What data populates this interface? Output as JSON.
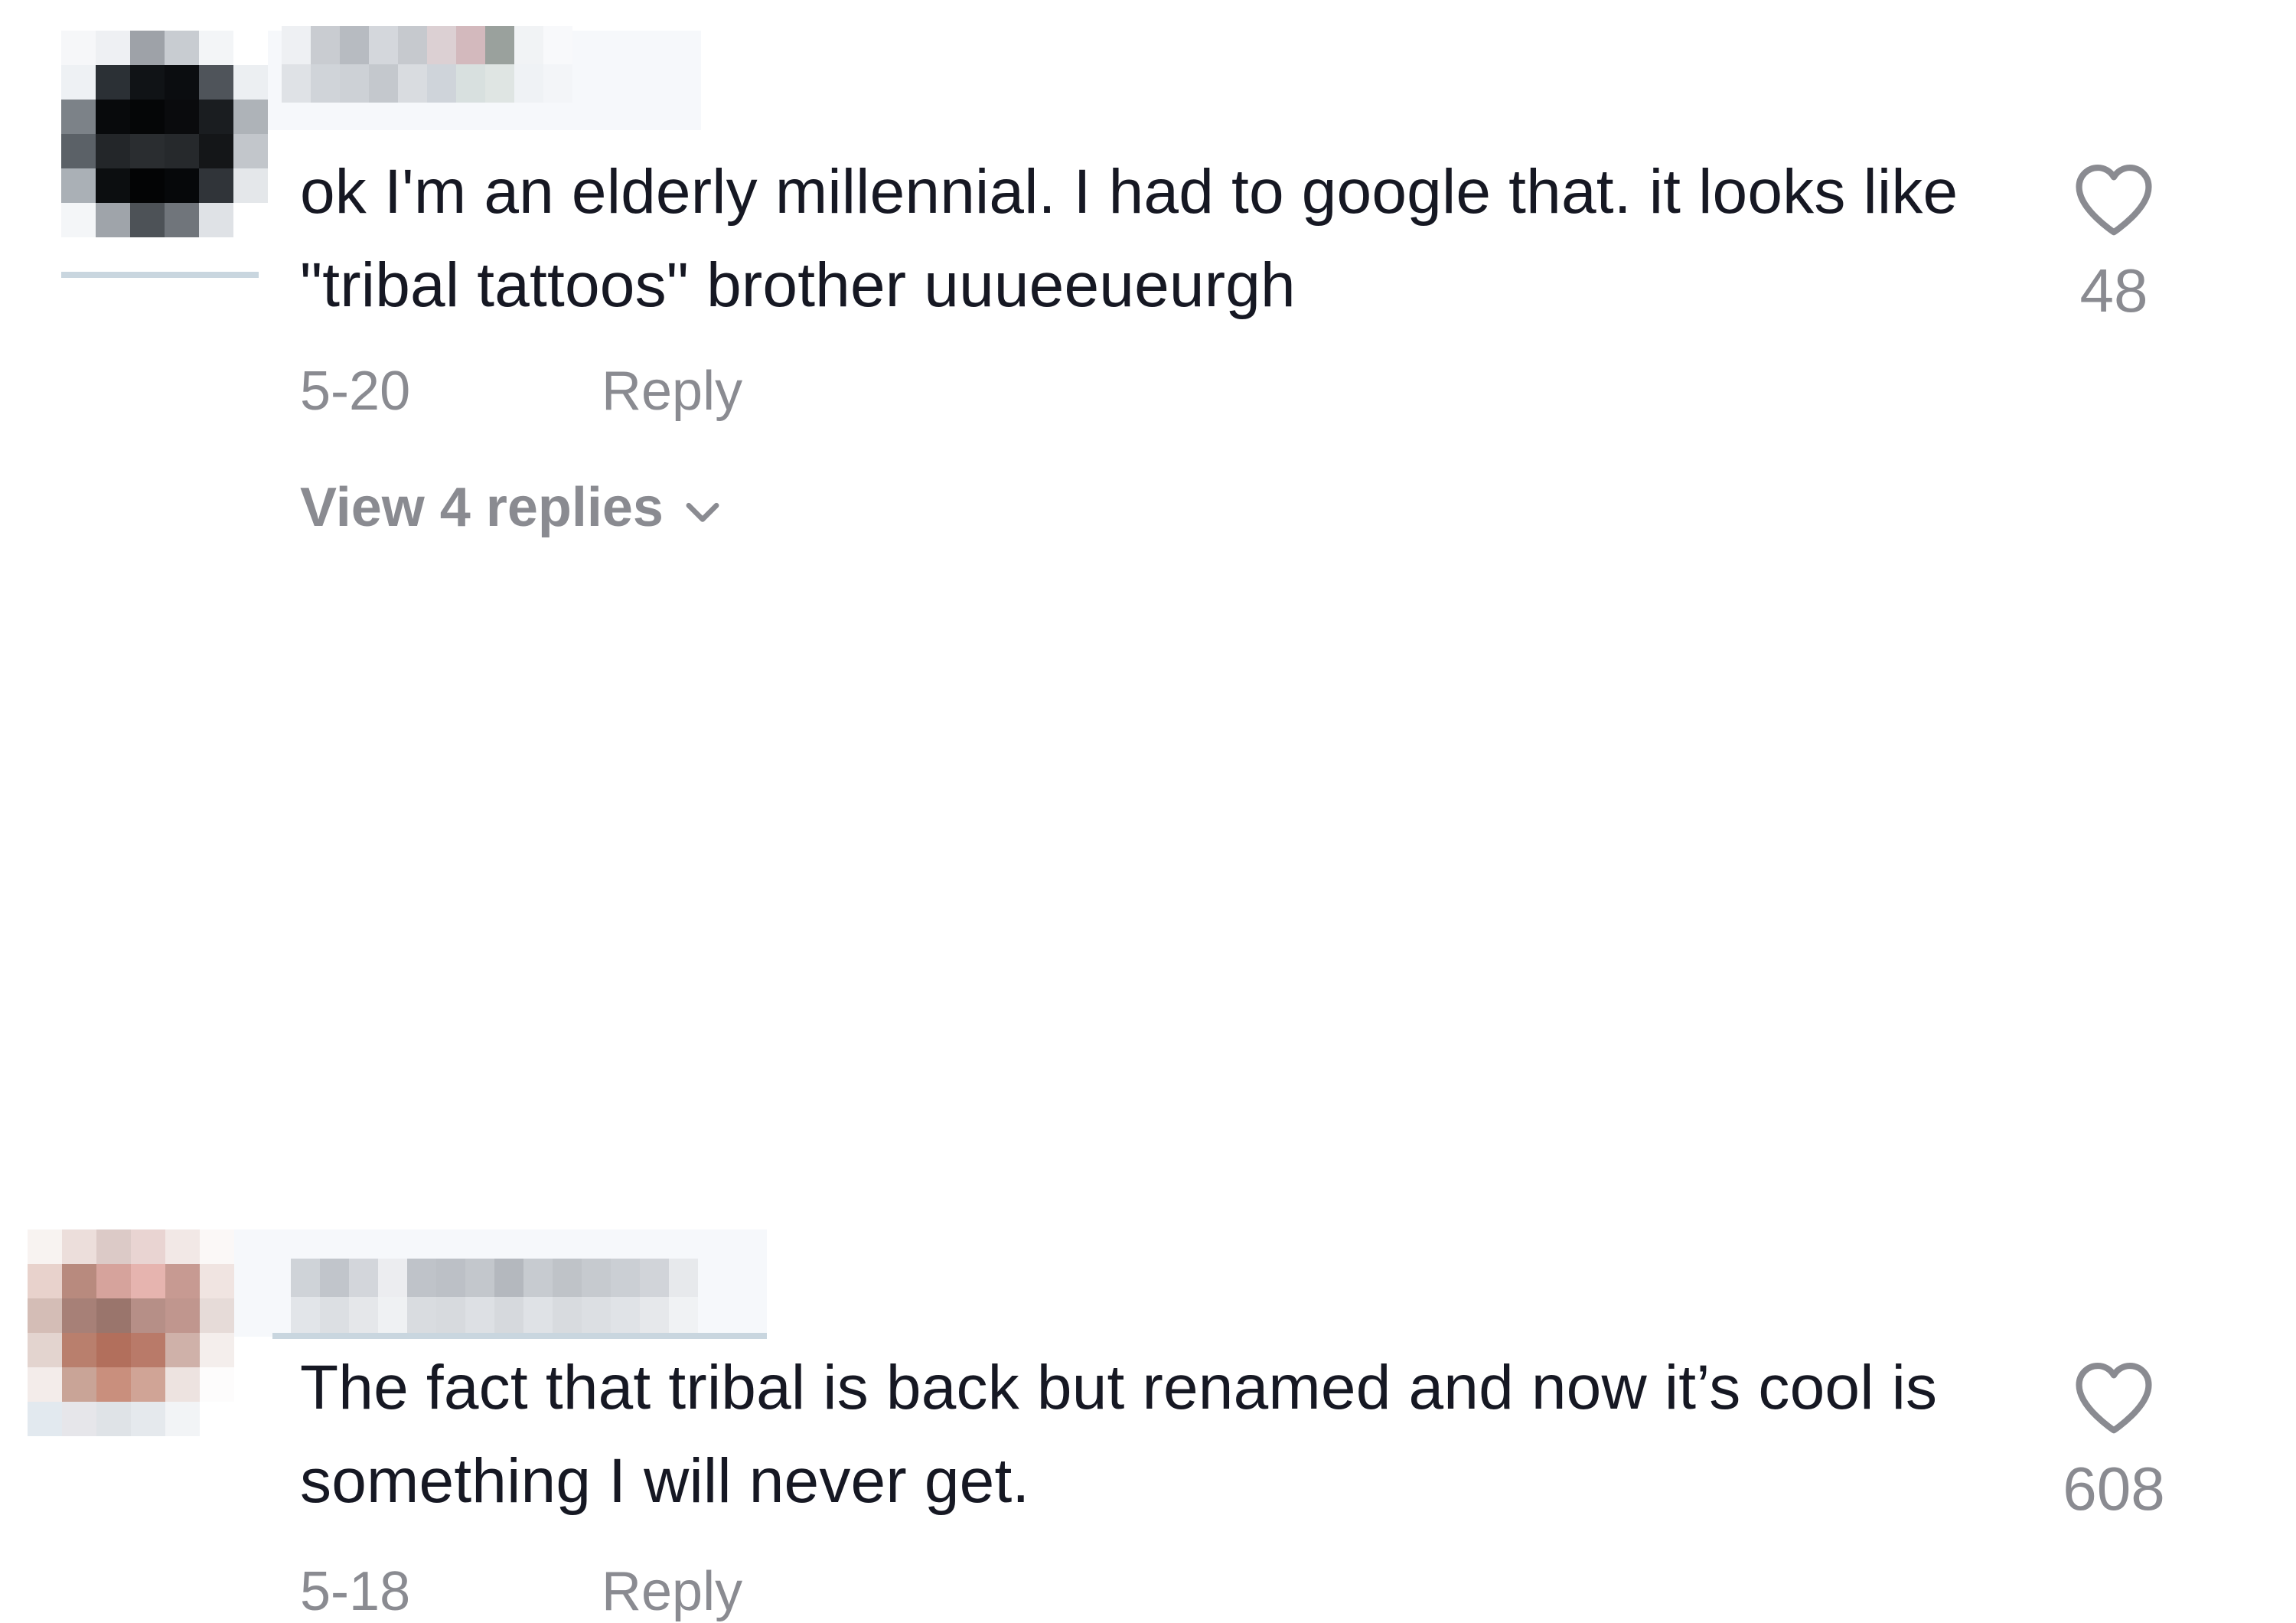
{
  "comments": [
    {
      "text": "ok I'm an elderly millennial. I had to google that. it looks like \"tribal tattoos\" brother uuueeueurgh",
      "date": "5-20",
      "reply_label": "Reply",
      "likes": "48",
      "view_replies_label": "View 4 replies",
      "icons": {
        "like": "heart-outline-icon",
        "expand": "chevron-down-icon"
      }
    },
    {
      "text": "The fact that tribal is back but renamed and now it’s cool is something I will never get.",
      "date": "5-18",
      "reply_label": "Reply",
      "likes": "608",
      "icons": {
        "like": "heart-outline-icon"
      }
    }
  ],
  "colors": {
    "text": "#161823",
    "secondary": "#8a8b91",
    "background": "#ffffff"
  }
}
